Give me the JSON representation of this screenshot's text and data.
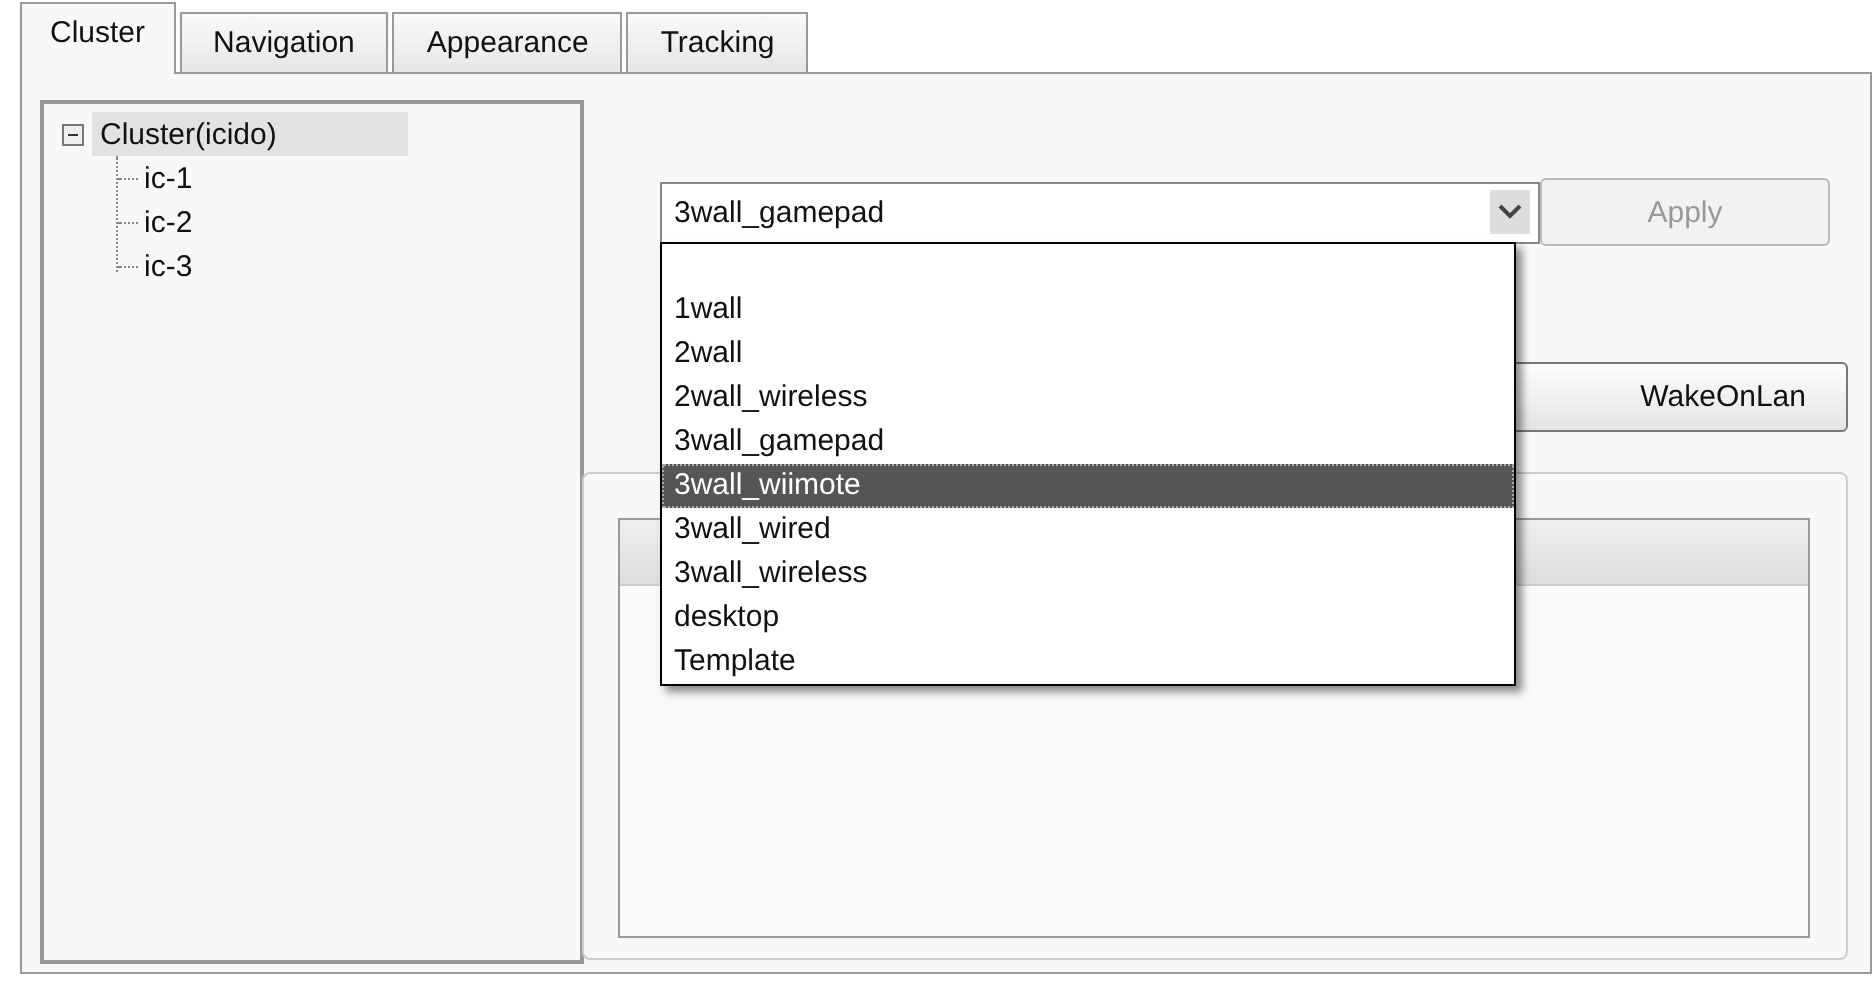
{
  "tabs": [
    {
      "label": "Cluster",
      "selected": true
    },
    {
      "label": "Navigation",
      "selected": false
    },
    {
      "label": "Appearance",
      "selected": false
    },
    {
      "label": "Tracking",
      "selected": false
    }
  ],
  "tree": {
    "label": "Cluster(icido)",
    "expanded": true,
    "selected": true,
    "children": [
      {
        "label": "ic-1",
        "selected": false
      },
      {
        "label": "ic-2",
        "selected": false
      },
      {
        "label": "ic-3",
        "selected": false
      }
    ]
  },
  "config_combo": {
    "value": "3wall_gamepad",
    "expanded": true,
    "options": [
      {
        "label": "1wall",
        "highlighted": false
      },
      {
        "label": "2wall",
        "highlighted": false
      },
      {
        "label": "2wall_wireless",
        "highlighted": false
      },
      {
        "label": "3wall_gamepad",
        "highlighted": false
      },
      {
        "label": "3wall_wiimote",
        "highlighted": true
      },
      {
        "label": "3wall_wired",
        "highlighted": false
      },
      {
        "label": "3wall_wireless",
        "highlighted": false
      },
      {
        "label": "desktop",
        "highlighted": false
      },
      {
        "label": "Template",
        "highlighted": false
      }
    ]
  },
  "apply_button": {
    "label": "Apply",
    "disabled": true
  },
  "wake_button": {
    "label": "WakeOnLan",
    "disabled": false
  }
}
